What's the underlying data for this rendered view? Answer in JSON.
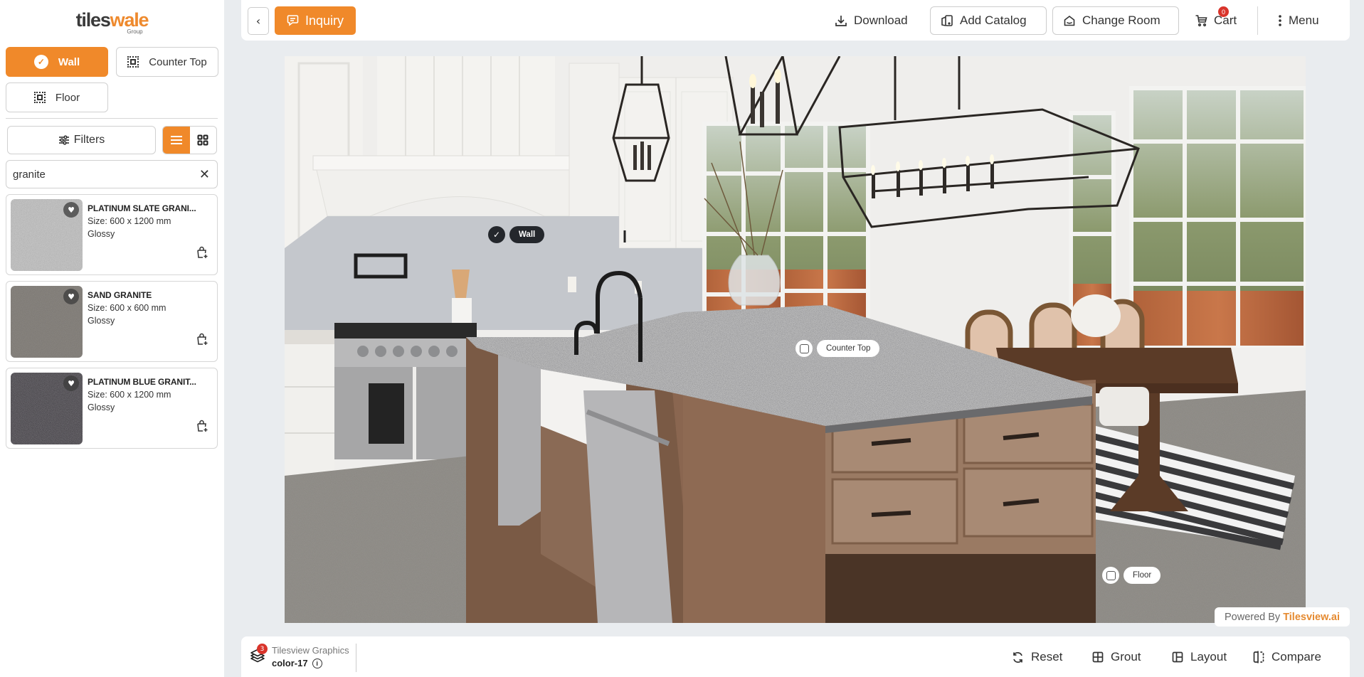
{
  "brand": {
    "logo_part1": "tiles",
    "logo_part2": "wale",
    "logo_sub": "Group",
    "accent_color": "#f0892a"
  },
  "sidebar": {
    "surfaces": [
      {
        "label": "Wall",
        "active": true,
        "icon": "check-badge-icon"
      },
      {
        "label": "Counter Top",
        "active": false,
        "icon": "select-area-icon"
      },
      {
        "label": "Floor",
        "active": false,
        "icon": "select-area-icon"
      }
    ],
    "filters_label": "Filters",
    "view_modes": [
      {
        "name": "list",
        "active": true
      },
      {
        "name": "grid",
        "active": false
      }
    ],
    "search": {
      "value": "granite",
      "placeholder": ""
    },
    "products": [
      {
        "name": "PLATINUM SLATE GRANI...",
        "size": "Size: 600 x 1200 mm",
        "finish": "Glossy",
        "swatch": "#9c9c9c"
      },
      {
        "name": "SAND GRANITE",
        "size": "Size: 600 x 600 mm",
        "finish": "Glossy",
        "swatch": "#7d7975"
      },
      {
        "name": "PLATINUM BLUE GRANIT...",
        "size": "Size: 600 x 1200 mm",
        "finish": "Glossy",
        "swatch": "#4e4b50"
      }
    ]
  },
  "topbar": {
    "back_label": "‹",
    "inquiry_label": "Inquiry",
    "download_label": "Download",
    "add_catalog_label": "Add Catalog",
    "change_room_label": "Change Room",
    "cart_label": "Cart",
    "cart_count": "0",
    "menu_label": "Menu"
  },
  "scene": {
    "tags": [
      {
        "label": "Wall",
        "selected": true
      },
      {
        "label": "Counter Top",
        "selected": false
      },
      {
        "label": "Floor",
        "selected": false
      }
    ],
    "powered_by_prefix": "Powered By",
    "powered_by_brand": "Tilesview.ai"
  },
  "bottombar": {
    "layers_count": "3",
    "graphics_name": "Tilesview Graphics",
    "color_name": "color-17",
    "reset_label": "Reset",
    "grout_label": "Grout",
    "layout_label": "Layout",
    "compare_label": "Compare"
  }
}
